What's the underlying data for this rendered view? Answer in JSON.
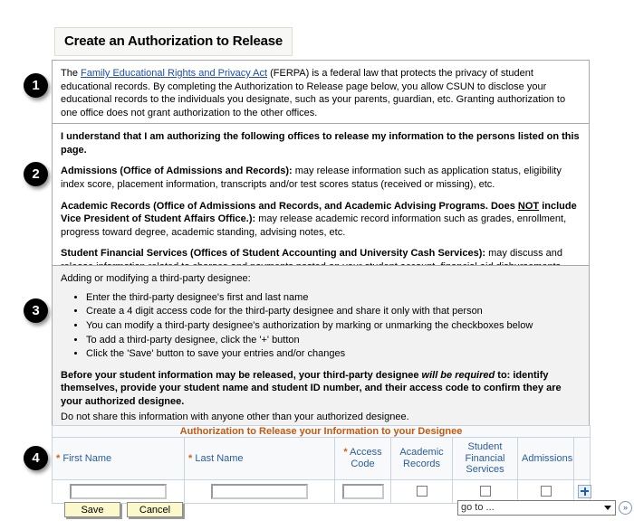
{
  "page_title": "Create an Authorization to Release",
  "badges": [
    "1",
    "2",
    "3",
    "4"
  ],
  "section1": {
    "lead": "The ",
    "link_text": "Family Educational Rights and Privacy Act",
    "rest": " (FERPA) is a federal law that protects the privacy of student educational records. By completing the Authorization to Release page below, you allow CSUN to disclose your educational records to the individuals you designate, such as your parents, guardian, etc. Granting authorization to one office does not grant authorization to the other offices."
  },
  "section2": {
    "heading": "I understand that I am authorizing the following offices to release my information to the persons listed on this page.",
    "admissions_label": "Admissions (Office of Admissions and Records):",
    "admissions_text": " may release information such as application status, eligibility index score, placement information, transcripts and/or test scores status (received or missing), etc.",
    "academic_label_a": "Academic Records (Office of Admissions and Records, and Academic Advising Programs. Does ",
    "academic_label_not": "NOT",
    "academic_label_b": " include Vice President of Student Affairs Office.):",
    "academic_text": " may release academic record information such as grades, enrollment, progress toward degree, academic standing, advising notes, etc.",
    "sfs_label": "Student Financial Services (Offices of Student Accounting and University Cash Services):",
    "sfs_text": " may discuss and release information related to charges and payments posted on your student account, financial aid disbursements, and enrollment status as it affects your financial obligations to the University."
  },
  "section3": {
    "heading": "Adding or modifying a third-party designee:",
    "bullets": [
      "Enter the third-party designee's first and last name",
      "Create a 4 digit access code for the third-party designee and share it only with that person",
      "You can modify a third-party designee's authorization by marking or unmarking the checkboxes below",
      "To add a third-party designee, click the '+' button",
      "Click the 'Save' button to save your entries and/or changes"
    ],
    "warn_a": "Before your student information may be released, your third-party designee ",
    "warn_em": "will be required",
    "warn_b": " to: identify themselves, provide your student name and student ID number, and their access code to confirm they are your authorized designee.",
    "note": "Do not share this information with anyone other than your authorized designee."
  },
  "grid": {
    "caption": "Authorization to Release your Information to your Designee",
    "required_marker": "*",
    "columns": {
      "first_name": "First Name",
      "last_name": "Last Name",
      "access_code_line1": "Access",
      "access_code_line2": "Code",
      "academic_records_line1": "Academic",
      "academic_records_line2": "Records",
      "student_financial_line1": "Student",
      "student_financial_line2": "Financial",
      "student_financial_line3": "Services",
      "admissions": "Admissions"
    },
    "row": {
      "first_name_value": "",
      "last_name_value": "",
      "access_code_value": "",
      "academic_records_checked": false,
      "student_financial_checked": false,
      "admissions_checked": false,
      "add_row_icon": "plus-icon"
    }
  },
  "footer": {
    "save_label": "Save",
    "cancel_label": "Cancel",
    "goto_value": "go to ...",
    "goto_go_glyph": "»"
  },
  "colors": {
    "link": "#1d4fa8",
    "grid_header_text": "#2a5d9e",
    "grid_caption": "#c35a10",
    "required": "#d4601a",
    "button_bg": "#fbf9cc",
    "badge_bg": "#000000"
  }
}
